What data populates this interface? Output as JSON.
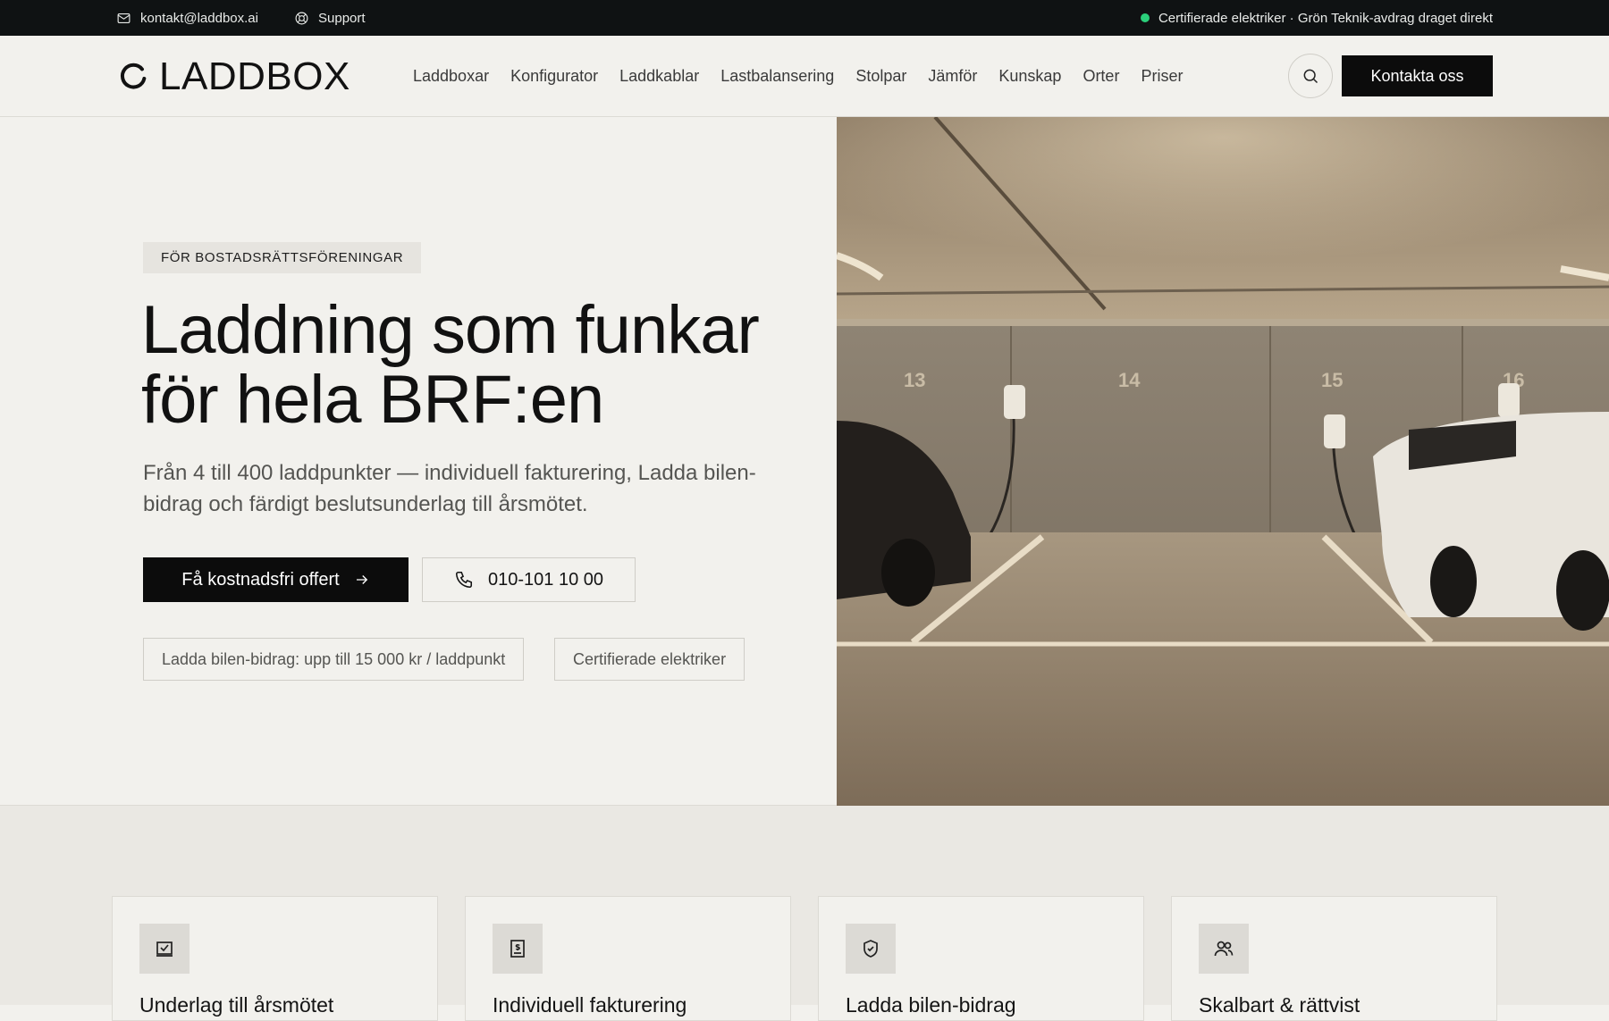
{
  "topbar": {
    "email": "kontakt@laddbox.ai",
    "support": "Support",
    "status": "Certifierade elektriker · Grön Teknik-avdrag draget direkt"
  },
  "header": {
    "logo_text": "LADDBOX",
    "nav": [
      "Laddboxar",
      "Konfigurator",
      "Laddkablar",
      "Lastbalansering",
      "Stolpar",
      "Jämför",
      "Kunskap",
      "Orter",
      "Priser"
    ],
    "contact_label": "Kontakta oss"
  },
  "hero": {
    "eyebrow": "FÖR BOSTADSRÄTTSFÖRENINGAR",
    "title_line1": "Laddning som funkar",
    "title_line2": "för hela BRF:en",
    "subtitle": "Från 4 till 400 laddpunkter — individuell fakturering, Ladda bilen-bidrag och färdigt beslutsunderlag till årsmötet.",
    "cta_primary": "Få kostnadsfri offert",
    "cta_phone": "010-101 10 00",
    "chips": [
      "Ladda bilen-bidrag: upp till 15 000 kr / laddpunkt",
      "Certifierade elektriker"
    ],
    "photo_bay_numbers": [
      "13",
      "14",
      "15",
      "16"
    ]
  },
  "features": [
    {
      "title": "Underlag till årsmötet",
      "icon": "checkbox-icon"
    },
    {
      "title": "Individuell fakturering",
      "icon": "invoice-icon"
    },
    {
      "title": "Ladda bilen-bidrag",
      "icon": "shield-check-icon"
    },
    {
      "title": "Skalbart & rättvist",
      "icon": "users-icon"
    }
  ],
  "colors": {
    "dark": "#0c0c0c",
    "background": "#f2f1ed",
    "status_green": "#2bd07b"
  }
}
